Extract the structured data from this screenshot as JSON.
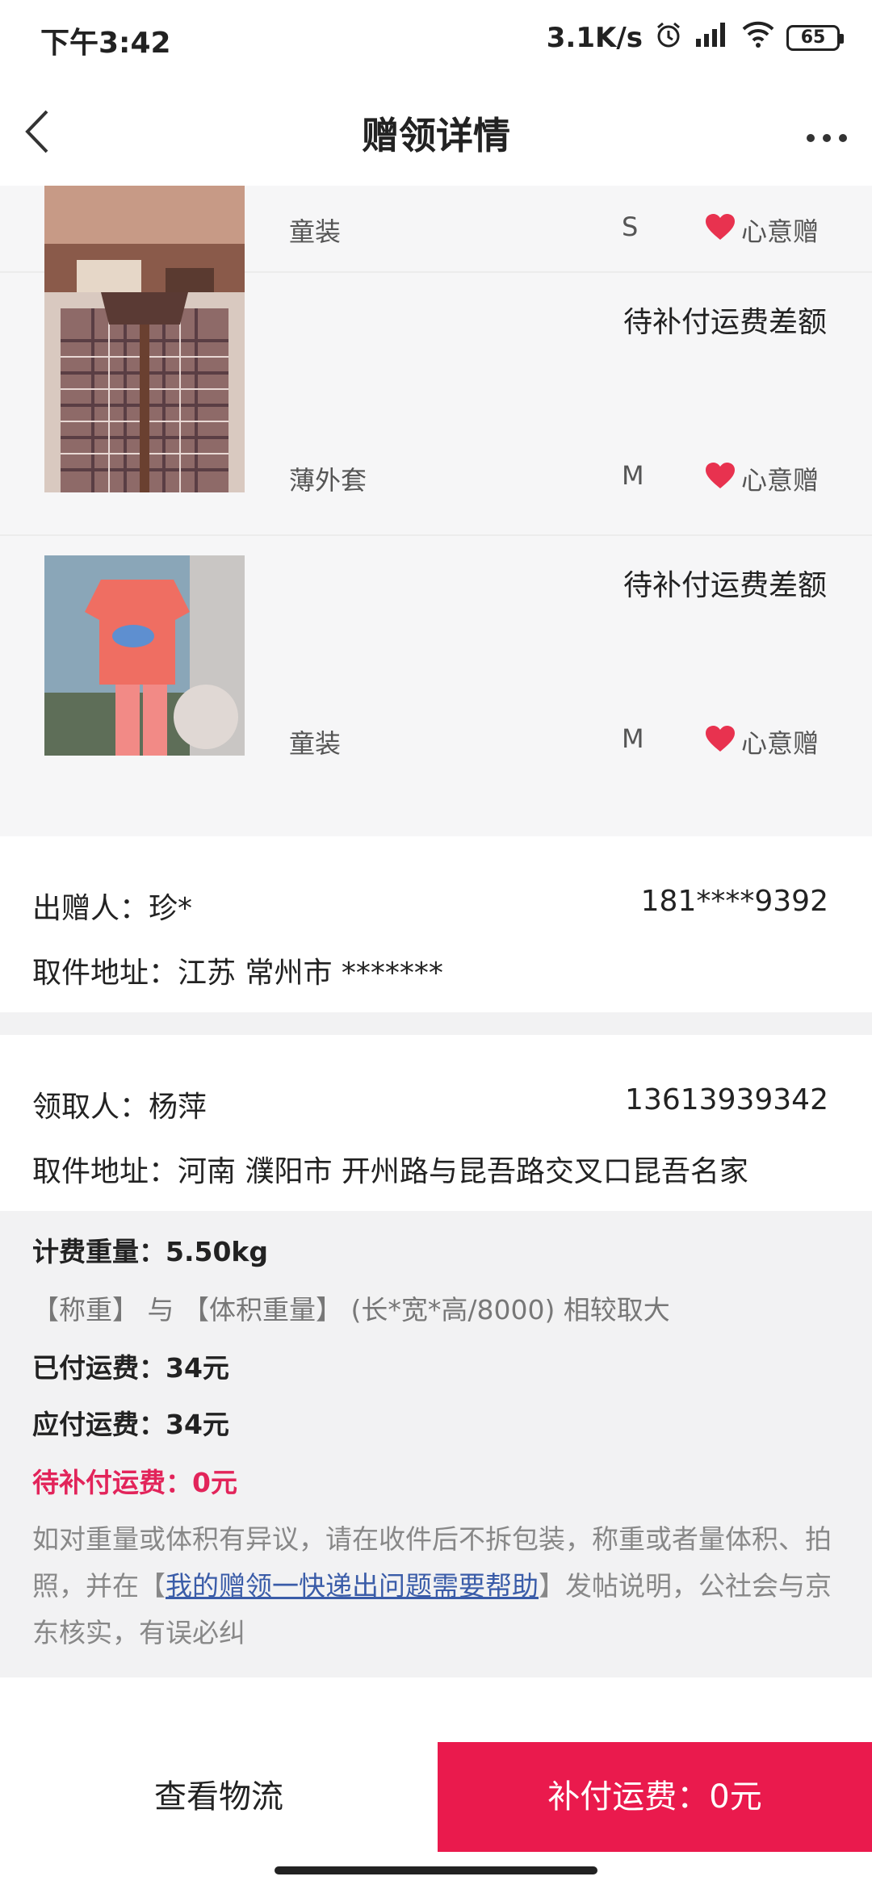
{
  "status_bar": {
    "time": "下午3:42",
    "network_speed": "3.1K/s",
    "battery": "65"
  },
  "nav": {
    "title": "赠领详情"
  },
  "items": [
    {
      "category": "童装",
      "size": "S",
      "tag": "心意赠",
      "status": ""
    },
    {
      "category": "薄外套",
      "size": "M",
      "tag": "心意赠",
      "status": "待补付运费差额"
    },
    {
      "category": "童装",
      "size": "M",
      "tag": "心意赠",
      "status": "待补付运费差额"
    }
  ],
  "giver": {
    "label": "出赠人：珍*",
    "phone": "181****9392",
    "address": "取件地址：江苏 常州市 *******"
  },
  "receiver": {
    "label": "领取人：杨萍",
    "phone": "13613939342",
    "address": "取件地址：河南 濮阳市 开州路与昆吾路交叉口昆吾名家"
  },
  "fee": {
    "weight": "计费重量：5.50kg",
    "rule": "【称重】 与 【体积重量】 (长*宽*高/8000) 相较取大",
    "paid": "已付运费：34元",
    "due": "应付运费：34元",
    "pending": "待补付运费：0元",
    "note_1": "如对重量或体积有异议，请在收件后不拆包装，称重或者量体积、拍照，并在【",
    "note_link": "我的赠领一快递出问题需要帮助",
    "note_2": "】发帖说明，公社会与京东核实，有误必纠"
  },
  "buttons": {
    "logistics": "查看物流",
    "pay": "补付运费：0元"
  },
  "colors": {
    "accent": "#ea1a4d",
    "pending_text": "#e2245a",
    "link": "#3a5ca8",
    "heart": "#e8324f"
  },
  "icons": [
    "back-arrow-icon",
    "more-icon",
    "heart-icon",
    "alarm-icon",
    "signal-icon",
    "wifi-icon",
    "battery-icon"
  ]
}
